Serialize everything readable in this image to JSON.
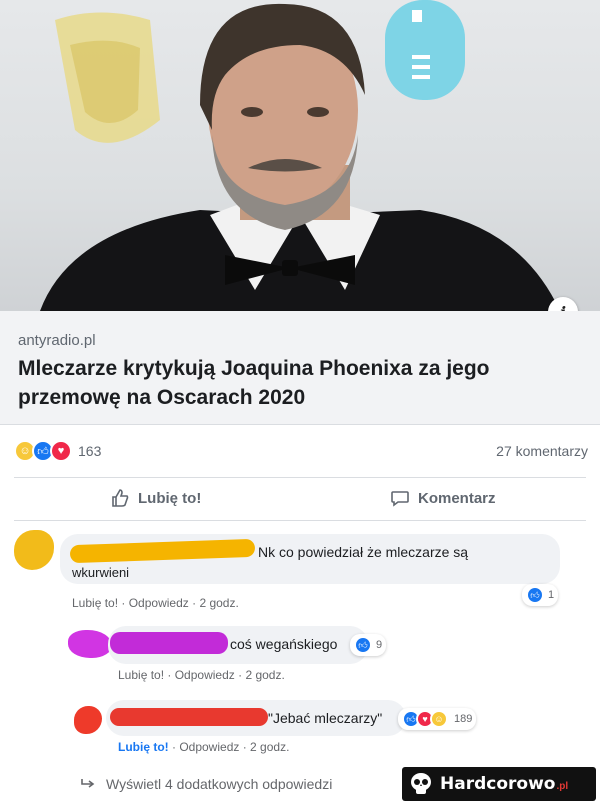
{
  "post": {
    "domain": "antyradio.pl",
    "headline": "Mleczarze krytykują Joaquina Phoenixa za jego przemowę na Oscarach 2020",
    "info_icon": "i",
    "reaction_count": "163",
    "comments_count": "27 komentarzy"
  },
  "actions": {
    "like_label": "Lubię to!",
    "comment_label": "Komentarz"
  },
  "comments": [
    {
      "text_line1": "Nk co powiedział że mleczarze są",
      "text_line2": "wkurwieni",
      "like": "Lubię to!",
      "reply": "Odpowiedz",
      "time": "2 godz.",
      "reaction_count": "1",
      "redact_color": "#f5b400",
      "avatar_color": "#f2bb1a"
    },
    {
      "text": "coś wegańskiego",
      "like": "Lubię to!",
      "reply": "Odpowiedz",
      "time": "2 godz.",
      "reaction_count": "9",
      "redact_color": "#c22bd8",
      "avatar_color": "#d135e3"
    },
    {
      "text": "\"Jebać mleczarzy\"",
      "like": "Lubię to!",
      "reply": "Odpowiedz",
      "time": "2 godz.",
      "reaction_count": "189",
      "redact_color": "#e8392f",
      "avatar_color": "#ee3a2a"
    }
  ],
  "more_replies": "Wyświetl 4 dodatkowych odpowiedzi",
  "watermark": {
    "text": "Hardcorowo",
    "suffix": ".pl"
  },
  "icons": [
    "info-icon",
    "haha-reaction-icon",
    "like-reaction-icon",
    "love-reaction-icon",
    "thumb-up-icon",
    "comment-bubble-icon",
    "reply-arrow-icon",
    "skull-logo-icon"
  ],
  "colors": {
    "facebook_blue": "#1877f2",
    "love_red": "#f0284a",
    "haha_yellow": "#f7c83a",
    "card_gray": "#f2f3f5"
  }
}
